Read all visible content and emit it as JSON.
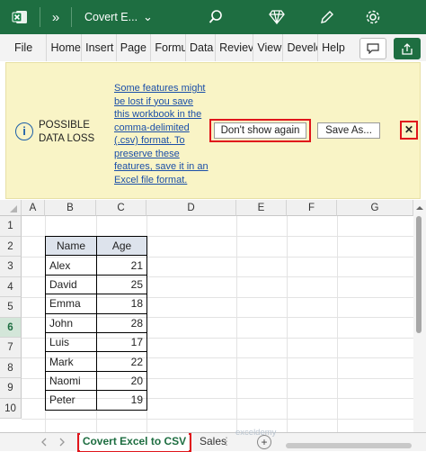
{
  "titlebar": {
    "more_glyph": "»",
    "doc_title": "Covert E...",
    "dropdown_glyph": "⌄"
  },
  "ribbon": {
    "tabs": [
      "File",
      "Home",
      "Insert",
      "Page L",
      "Formu",
      "Data",
      "Reviev",
      "View",
      "Develc",
      "Help"
    ]
  },
  "message_bar": {
    "title": "POSSIBLE DATA LOSS",
    "text": "Some features might be lost if you save this workbook in the comma-delimited (.csv) format. To preserve these features, save it in an Excel file format.",
    "dont_show_again": "Don't show again",
    "save_as": "Save As...",
    "close_glyph": "✕",
    "info_glyph": "i"
  },
  "grid": {
    "columns": [
      "A",
      "B",
      "C",
      "D",
      "E",
      "F",
      "G"
    ],
    "rows": [
      "1",
      "2",
      "3",
      "4",
      "5",
      "6",
      "7",
      "8",
      "9",
      "10"
    ],
    "table_headers": [
      "Name",
      "Age"
    ],
    "table_rows": [
      {
        "name": "Alex",
        "age": "21"
      },
      {
        "name": "David",
        "age": "25"
      },
      {
        "name": "Emma",
        "age": "18"
      },
      {
        "name": "John",
        "age": "28"
      },
      {
        "name": "Luis",
        "age": "17"
      },
      {
        "name": "Mark",
        "age": "22"
      },
      {
        "name": "Naomi",
        "age": "20"
      },
      {
        "name": "Peter",
        "age": "19"
      }
    ]
  },
  "sheets": {
    "active": "Covert Excel to CSV",
    "other": "Sales",
    "add_glyph": "+",
    "menu_glyph": "⋮",
    "watermark": "exceldemy"
  }
}
